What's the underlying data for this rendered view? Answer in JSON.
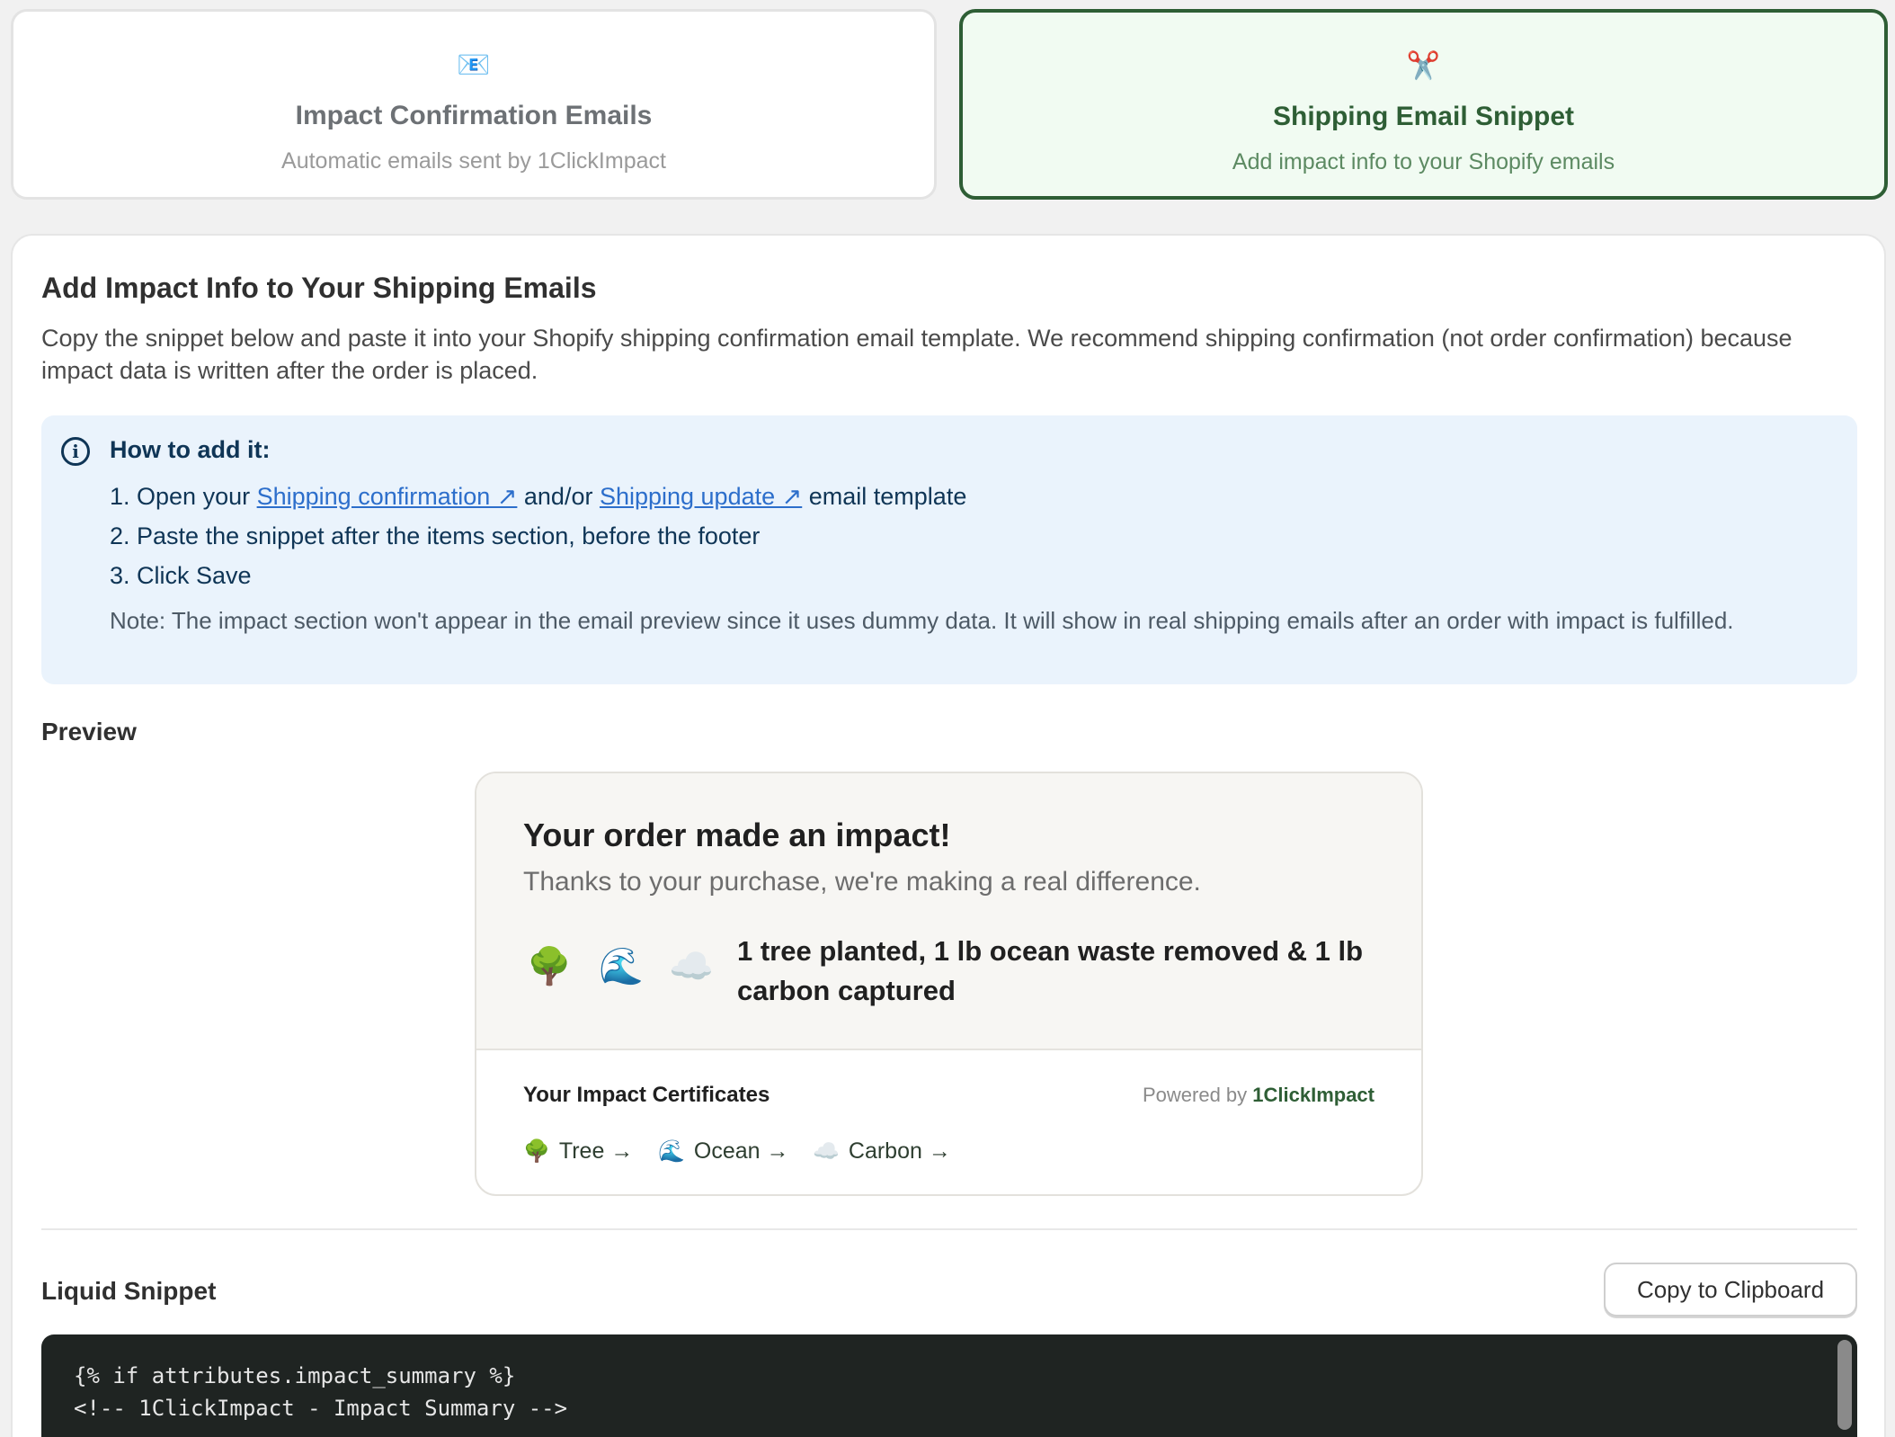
{
  "tabs": [
    {
      "icon": "email-icon",
      "glyph": "📧",
      "title": "Impact Confirmation Emails",
      "subtitle": "Automatic emails sent by 1ClickImpact",
      "selected": false
    },
    {
      "icon": "scissors-icon",
      "glyph": "✂️",
      "title": "Shipping Email Snippet",
      "subtitle": "Add impact info to your Shopify emails",
      "selected": true
    }
  ],
  "panel": {
    "title": "Add Impact Info to Your Shipping Emails",
    "description": "Copy the snippet below and paste it into your Shopify shipping confirmation email template. We recommend shipping confirmation (not order confirmation) because impact data is written after the order is placed."
  },
  "info": {
    "heading": "How to add it:",
    "step1_prefix": "1. Open your ",
    "step1_link1": "Shipping confirmation ↗",
    "step1_middle": " and/or ",
    "step1_link2": "Shipping update ↗",
    "step1_suffix": " email template",
    "step2": "2. Paste the snippet after the items section, before the footer",
    "step3": "3. Click Save",
    "note": "Note: The impact section won't appear in the email preview since it uses dummy data. It will show in real shipping emails after an order with impact is fulfilled."
  },
  "preview": {
    "label": "Preview",
    "heading": "Your order made an impact!",
    "thanks": "Thanks to your purchase, we're making a real difference.",
    "icons": {
      "tree": "🌳",
      "ocean": "🌊",
      "carbon": "☁️"
    },
    "summary": "1 tree planted, 1 lb ocean waste removed & 1 lb carbon captured",
    "certificates_heading": "Your Impact Certificates",
    "powered_prefix": "Powered by ",
    "powered_brand": "1ClickImpact",
    "cert_links": {
      "tree": "Tree →",
      "ocean": "Ocean →",
      "carbon": "Carbon →"
    }
  },
  "snippet": {
    "label": "Liquid Snippet",
    "copy_button": "Copy to Clipboard",
    "lines": [
      "{% if attributes.impact_summary %}",
      "<!-- 1ClickImpact - Impact Summary -->"
    ]
  }
}
